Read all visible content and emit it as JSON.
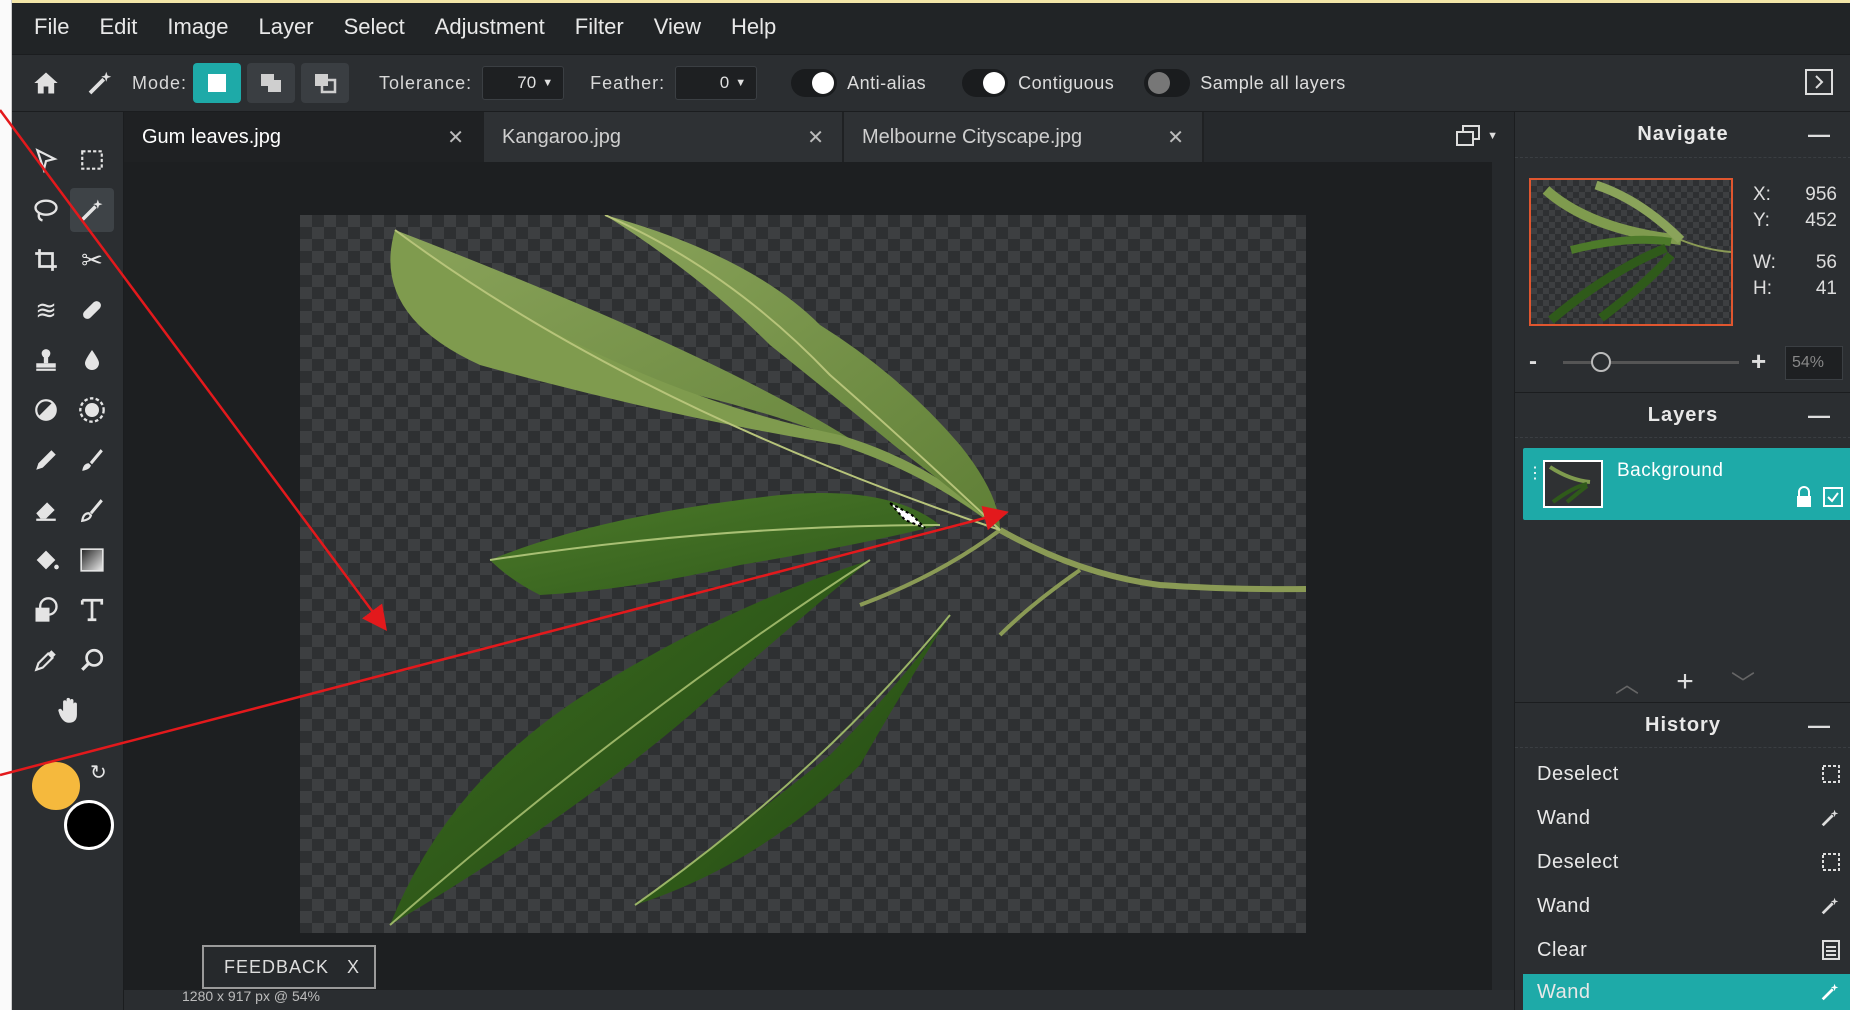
{
  "menu": [
    "File",
    "Edit",
    "Image",
    "Layer",
    "Select",
    "Adjustment",
    "Filter",
    "View",
    "Help"
  ],
  "toolbar": {
    "mode_label": "Mode:",
    "tolerance_label": "Tolerance:",
    "tolerance_value": "70",
    "feather_label": "Feather:",
    "feather_value": "0",
    "antialias_label": "Anti-alias",
    "contiguous_label": "Contiguous",
    "sample_label": "Sample all layers"
  },
  "tabs": [
    {
      "label": "Gum leaves.jpg",
      "active": true
    },
    {
      "label": "Kangaroo.jpg",
      "active": false
    },
    {
      "label": "Melbourne Cityscape.jpg",
      "active": false
    }
  ],
  "navigate": {
    "title": "Navigate",
    "x_label": "X:",
    "x": "956",
    "y_label": "Y:",
    "y": "452",
    "w_label": "W:",
    "w": "56",
    "h_label": "H:",
    "h": "41",
    "zoom": "54%",
    "minus": "-",
    "plus": "+"
  },
  "layers": {
    "title": "Layers",
    "items": [
      {
        "name": "Background"
      }
    ]
  },
  "history": {
    "title": "History",
    "items": [
      {
        "label": "Deselect",
        "icon": "selection-icon"
      },
      {
        "label": "Wand",
        "icon": "wand-icon"
      },
      {
        "label": "Deselect",
        "icon": "selection-icon"
      },
      {
        "label": "Wand",
        "icon": "wand-icon"
      },
      {
        "label": "Clear",
        "icon": "clear-icon"
      },
      {
        "label": "Wand",
        "icon": "wand-icon",
        "active": true
      }
    ]
  },
  "feedback": {
    "label": "FEEDBACK",
    "close": "X"
  },
  "status": "1280 x 917 px @ 54%",
  "colors": {
    "accent": "#1eaaa8",
    "foreground": "#f5b93d",
    "background": "#000000",
    "annotation": "#e3191c"
  }
}
